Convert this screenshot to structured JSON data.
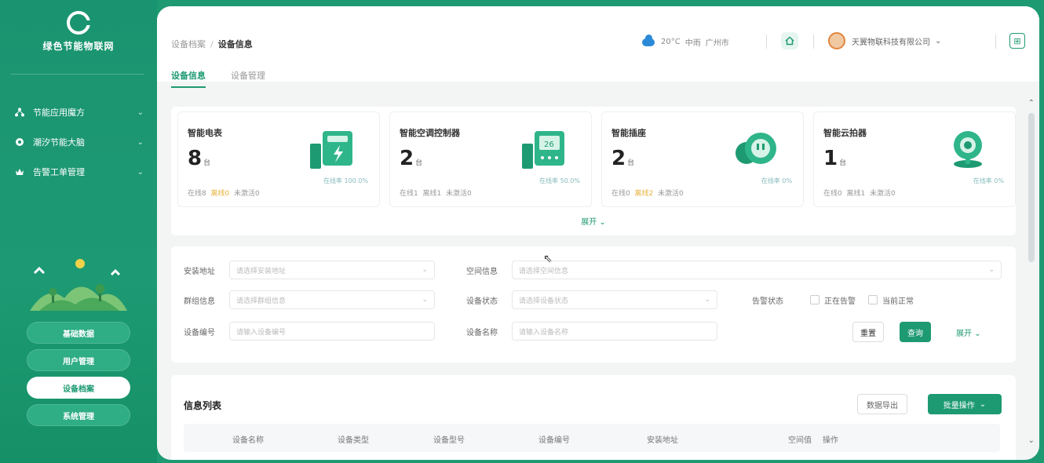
{
  "sidebar": {
    "logo_text": "绿色节能物联网",
    "menu": [
      {
        "icon": "network-icon",
        "label": "节能应用魔方"
      },
      {
        "icon": "location-icon",
        "label": "潮汐节能大脑"
      },
      {
        "icon": "crown-icon",
        "label": "告警工单管理"
      }
    ],
    "nav": [
      {
        "label": "基础数据",
        "active": false
      },
      {
        "label": "用户管理",
        "active": false
      },
      {
        "label": "设备档案",
        "active": true
      },
      {
        "label": "系统管理",
        "active": false
      }
    ]
  },
  "header": {
    "breadcrumb": {
      "parent": "设备档案",
      "current": "设备信息"
    },
    "weather": {
      "temp": "20°C",
      "condition": "中雨",
      "city": "广州市"
    },
    "user": {
      "company": "天翼物联科技有限公司"
    }
  },
  "tabs": [
    {
      "label": "设备信息",
      "active": true
    },
    {
      "label": "设备管理",
      "active": false
    }
  ],
  "stats": [
    {
      "name": "智能电表",
      "count": "8",
      "unit": "台",
      "online": "在线8",
      "offline": "离线0",
      "unconnected": "未激活0",
      "rate": "在线率 100.0%"
    },
    {
      "name": "智能空调控制器",
      "count": "2",
      "unit": "台",
      "online": "在线1",
      "offline": "离线1",
      "unconnected": "未激活0",
      "rate": "在线率 50.0%"
    },
    {
      "name": "智能插座",
      "count": "2",
      "unit": "台",
      "online": "在线0",
      "offline": "离线2",
      "unconnected": "未激活0",
      "rate": "在线率 0%"
    },
    {
      "name": "智能云拍器",
      "count": "1",
      "unit": "台",
      "online": "在线0",
      "offline": "离线1",
      "unconnected": "未激活0",
      "rate": "在线率 0%"
    }
  ],
  "stats_expand": "展开",
  "filters": {
    "install_addr": {
      "label": "安装地址",
      "placeholder": "请选择安装地址"
    },
    "space_info": {
      "label": "空间信息",
      "placeholder": "请选择空间信息"
    },
    "group_info": {
      "label": "群组信息",
      "placeholder": "请选择群组信息"
    },
    "device_status": {
      "label": "设备状态",
      "placeholder": "请选择设备状态"
    },
    "alarm_status": {
      "label": "告警状态",
      "opt1": "正在告警",
      "opt2": "当前正常"
    },
    "device_no": {
      "label": "设备编号",
      "placeholder": "请输入设备编号"
    },
    "device_name": {
      "label": "设备名称",
      "placeholder": "请输入设备名称"
    },
    "reset": "重置",
    "query": "查询",
    "expand": "展开"
  },
  "list": {
    "title": "信息列表",
    "export": "数据导出",
    "batch": "批量操作",
    "columns": [
      "设备名称",
      "设备类型",
      "设备型号",
      "设备编号",
      "安装地址",
      "空间值",
      "操作"
    ]
  },
  "colors": {
    "brand": "#1e9a72",
    "warning": "#e6b03c"
  }
}
